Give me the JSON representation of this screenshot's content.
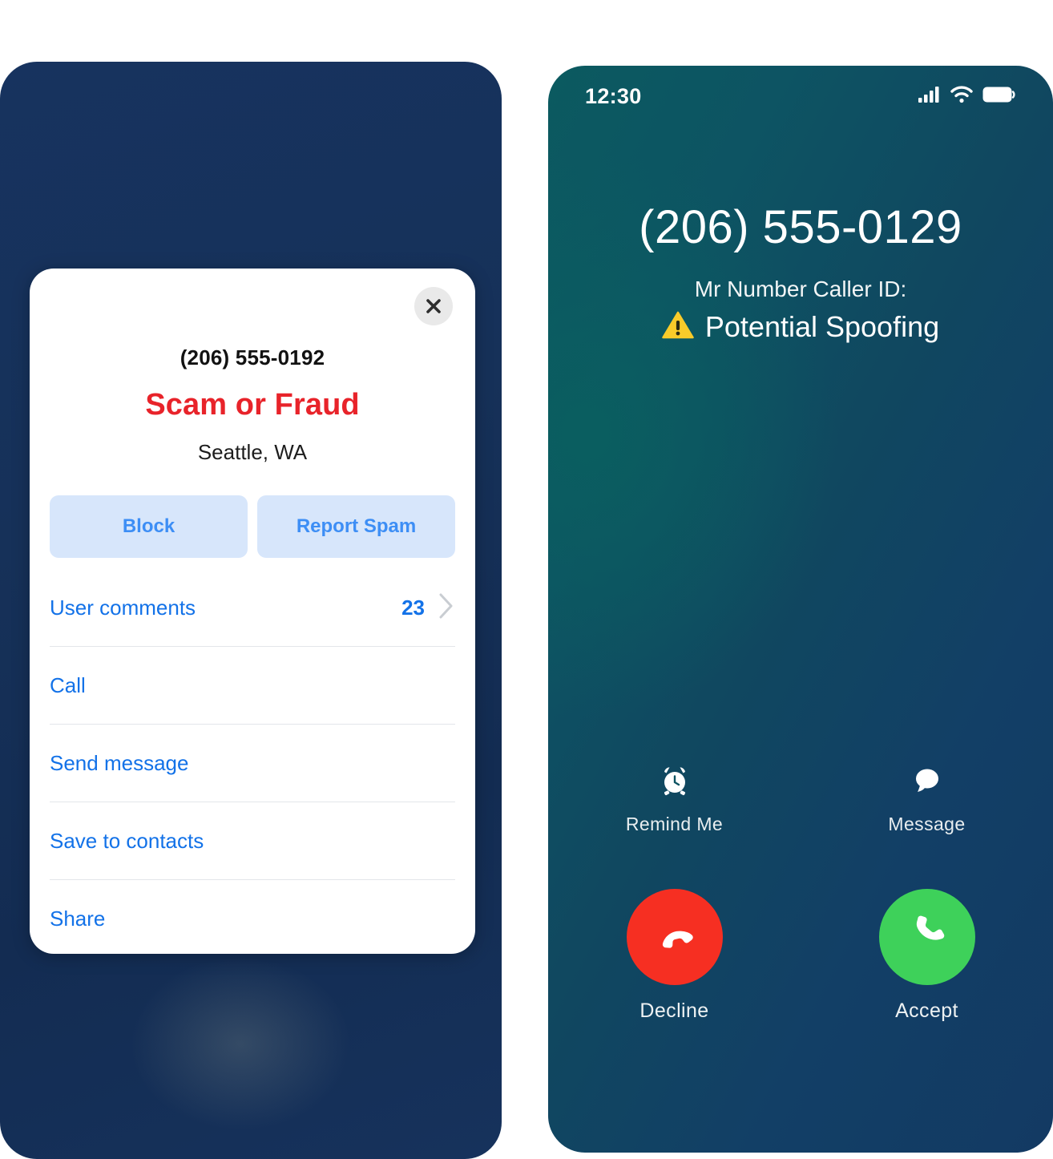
{
  "left_phone": {
    "card": {
      "close_icon": "close-icon",
      "phone_number": "(206) 555-0192",
      "verdict": "Scam or Fraud",
      "location": "Seattle, WA",
      "actions": [
        {
          "label": "Block"
        },
        {
          "label": "Report Spam"
        }
      ],
      "menu_items": [
        {
          "label": "User comments",
          "count": "23",
          "chevron_icon": "chevron-right-icon"
        },
        {
          "label": "Call"
        },
        {
          "label": "Send message"
        },
        {
          "label": "Save to contacts"
        },
        {
          "label": "Share"
        }
      ]
    }
  },
  "right_phone": {
    "status_bar": {
      "time": "12:30",
      "cellular_icon": "cellular-signal-icon",
      "wifi_icon": "wifi-icon",
      "battery_icon": "battery-icon"
    },
    "incoming_call": {
      "number": "(206) 555-0129",
      "caller_id_label": "Mr Number Caller ID:",
      "warning_icon": "warning-triangle-icon",
      "caller_id_status": "Potential Spoofing"
    },
    "secondary_actions": [
      {
        "label": "Remind Me",
        "icon": "alarm-clock-icon"
      },
      {
        "label": "Message",
        "icon": "message-bubble-icon"
      }
    ],
    "call_actions": [
      {
        "label": "Decline",
        "icon": "phone-down-icon"
      },
      {
        "label": "Accept",
        "icon": "phone-up-icon"
      }
    ]
  },
  "colors": {
    "left_phone_bg": "#16325c",
    "card_bg": "#ffffff",
    "verdict_red": "#e8232a",
    "link_blue": "#1372e8",
    "action_btn_bg": "#d7e6fb",
    "action_btn_text": "#3d8ef5",
    "right_phone_teal": "#0b5a60",
    "right_phone_blue": "#133a63",
    "warning_yellow": "#f9cb2a",
    "decline_red": "#f62f22",
    "accept_green": "#3ed15a"
  }
}
